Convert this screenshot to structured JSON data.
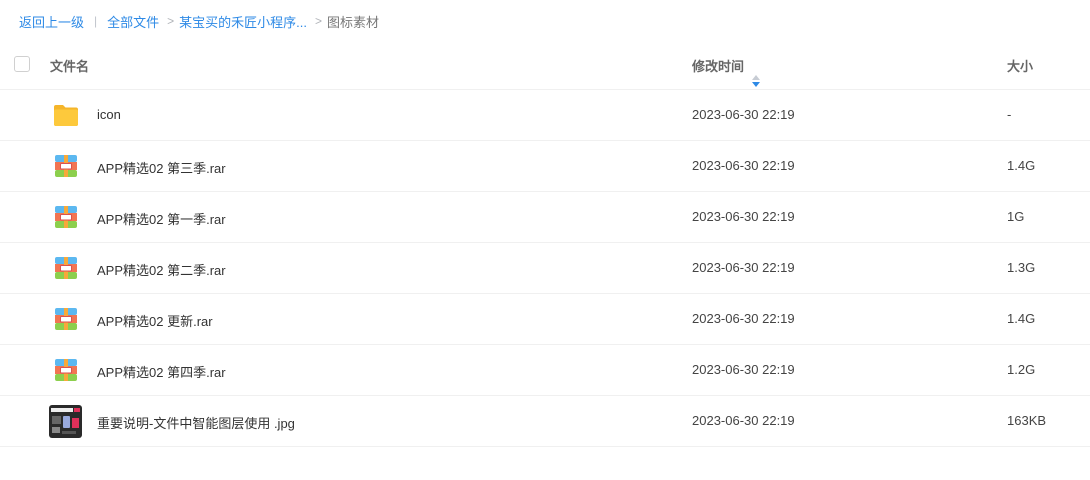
{
  "breadcrumb": {
    "back": "返回上一级",
    "separator": "|",
    "items": [
      "全部文件",
      "某宝买的禾匠小程序...",
      "图标素材"
    ],
    "arrow": ">"
  },
  "table": {
    "columns": {
      "name": "文件名",
      "modified": "修改时间",
      "size": "大小"
    },
    "sort": {
      "column": "modified",
      "direction": "desc"
    },
    "rows": [
      {
        "name": "icon",
        "modified": "2023-06-30 22:19",
        "size": "-",
        "icon": "folder-icon"
      },
      {
        "name": "APP精选02 第三季.rar",
        "modified": "2023-06-30 22:19",
        "size": "1.4G",
        "icon": "archive-icon"
      },
      {
        "name": "APP精选02 第一季.rar",
        "modified": "2023-06-30 22:19",
        "size": "1G",
        "icon": "archive-icon"
      },
      {
        "name": "APP精选02 第二季.rar",
        "modified": "2023-06-30 22:19",
        "size": "1.3G",
        "icon": "archive-icon"
      },
      {
        "name": "APP精选02 更新.rar",
        "modified": "2023-06-30 22:19",
        "size": "1.4G",
        "icon": "archive-icon"
      },
      {
        "name": "APP精选02 第四季.rar",
        "modified": "2023-06-30 22:19",
        "size": "1.2G",
        "icon": "archive-icon"
      },
      {
        "name": "重要说明-文件中智能图层使用 .jpg",
        "modified": "2023-06-30 22:19",
        "size": "163KB",
        "icon": "image-thumbnail"
      }
    ]
  },
  "colors": {
    "link": "#2e8ae6",
    "divider": "#f0f0f0",
    "folder": "#fcc63a",
    "archive_top": "#5cb8f0",
    "archive_mid": "#f27552",
    "archive_bottom": "#8ccf4d"
  }
}
